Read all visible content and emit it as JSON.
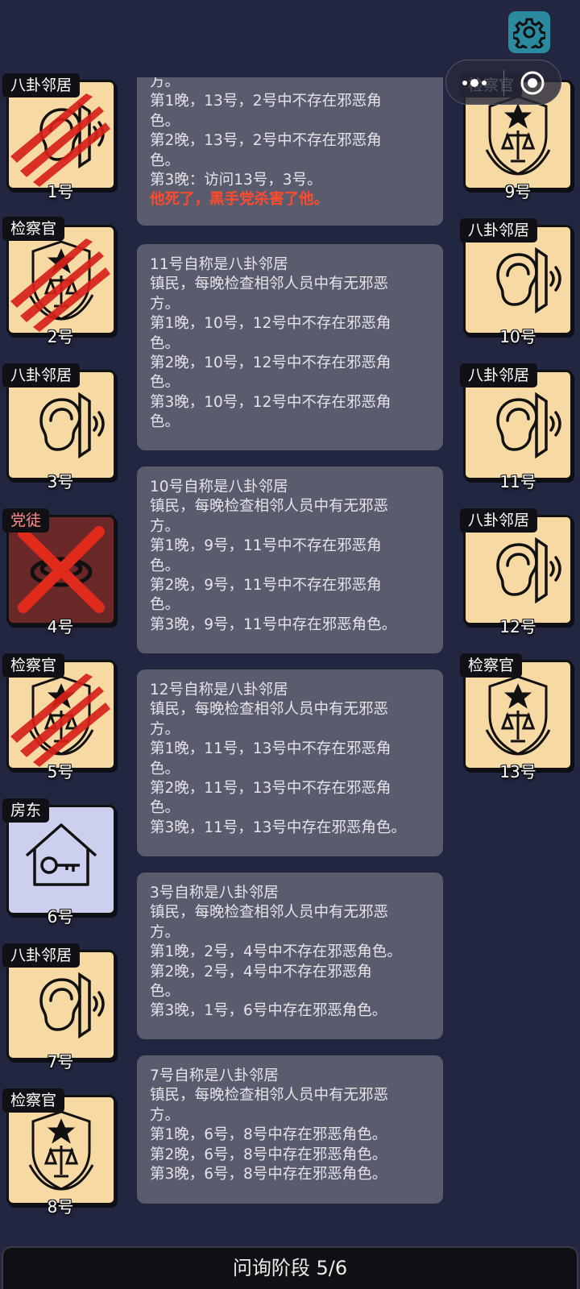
{
  "phase": {
    "label": "问询阶段 5/6"
  },
  "icons": {
    "settings": "gear-icon",
    "more": "more-dots-icon",
    "close": "close-target-icon"
  },
  "players_left": [
    {
      "num": "1号",
      "role": "八卦邻居",
      "art": "ear-icon",
      "status": "dead"
    },
    {
      "num": "2号",
      "role": "检察官",
      "art": "justice-badge-icon",
      "status": "dead"
    },
    {
      "num": "3号",
      "role": "八卦邻居",
      "art": "ear-icon",
      "status": "alive"
    },
    {
      "num": "4号",
      "role": "党徒",
      "art": "ring-icon",
      "status": "eliminated"
    },
    {
      "num": "5号",
      "role": "检察官",
      "art": "justice-badge-icon",
      "status": "dead"
    },
    {
      "num": "6号",
      "role": "房东",
      "art": "house-key-icon",
      "status": "alive"
    },
    {
      "num": "7号",
      "role": "八卦邻居",
      "art": "ear-icon",
      "status": "alive"
    },
    {
      "num": "8号",
      "role": "检察官",
      "art": "justice-badge-icon",
      "status": "alive"
    }
  ],
  "players_right": [
    {
      "num": "9号",
      "role": "检察官",
      "art": "justice-badge-icon",
      "status": "alive"
    },
    {
      "num": "10号",
      "role": "八卦邻居",
      "art": "ear-icon",
      "status": "alive"
    },
    {
      "num": "11号",
      "role": "八卦邻居",
      "art": "ear-icon",
      "status": "alive"
    },
    {
      "num": "12号",
      "role": "八卦邻居",
      "art": "ear-icon",
      "status": "alive"
    },
    {
      "num": "13号",
      "role": "检察官",
      "art": "justice-badge-icon",
      "status": "alive"
    }
  ],
  "messages": [
    {
      "lines": [
        "方。",
        "第1晚，13号，2号中不存在邪恶角",
        "色。",
        "第2晚，13号，2号中不存在邪恶角",
        "色。",
        "第3晚：访问13号，3号。"
      ],
      "death": "他死了，黑手党杀害了他。"
    },
    {
      "lines": [
        "11号自称是八卦邻居",
        "镇民，每晚检查相邻人员中有无邪恶",
        "方。",
        "第1晚，10号，12号中不存在邪恶角",
        "色。",
        "第2晚，10号，12号中不存在邪恶角",
        "色。",
        "第3晚，10号，12号中不存在邪恶角",
        "色。"
      ]
    },
    {
      "lines": [
        "10号自称是八卦邻居",
        "镇民，每晚检查相邻人员中有无邪恶",
        "方。",
        "第1晚，9号，11号中不存在邪恶角",
        "色。",
        "第2晚，9号，11号中不存在邪恶角",
        "色。",
        "第3晚，9号，11号中存在邪恶角色。"
      ]
    },
    {
      "lines": [
        "12号自称是八卦邻居",
        "镇民，每晚检查相邻人员中有无邪恶",
        "方。",
        "第1晚，11号，13号中不存在邪恶角",
        "色。",
        "第2晚，11号，13号中不存在邪恶角",
        "色。",
        "第3晚，11号，13号中存在邪恶角色。"
      ]
    },
    {
      "lines": [
        "3号自称是八卦邻居",
        "镇民，每晚检查相邻人员中有无邪恶",
        "方。",
        "第1晚，2号，4号中不存在邪恶角色。",
        "第2晚，2号，4号中不存在邪恶角",
        "色。",
        "第3晚，1号，6号中存在邪恶角色。"
      ]
    },
    {
      "lines": [
        "7号自称是八卦邻居",
        "镇民，每晚检查相邻人员中有无邪恶",
        "方。",
        "第1晚，6号，8号中存在邪恶角色。",
        "第2晚，6号，8号中存在邪恶角色。",
        "第3晚，6号，8号中存在邪恶角色。"
      ]
    }
  ]
}
